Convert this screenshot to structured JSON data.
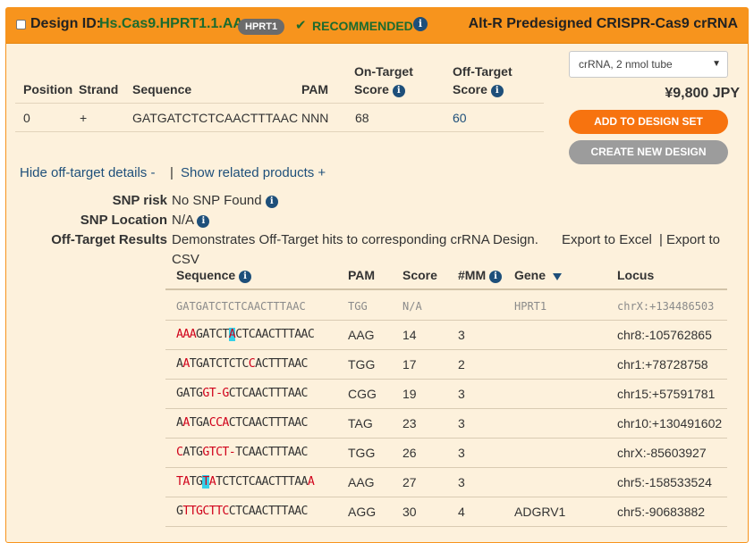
{
  "header": {
    "label": "Design ID:",
    "design_id": "Hs.Cas9.HPRT1.1.AA",
    "gene_badge": "HPRT1",
    "recommended": "RECOMMENDED",
    "product": "Alt-R Predesigned CRISPR-Cas9 crRNA"
  },
  "summary": {
    "headers": {
      "position": "Position",
      "strand": "Strand",
      "sequence": "Sequence",
      "pam": "PAM",
      "on_target_1": "On-Target",
      "on_target_2": "Score",
      "off_target_1": "Off-Target",
      "off_target_2": "Score"
    },
    "row": {
      "position": "0",
      "strand": "+",
      "sequence": "GATGATCTCTCAACTTTAAC",
      "pam": "NNN",
      "on_target": "68",
      "off_target": "60"
    }
  },
  "order": {
    "select_value": "crRNA, 2 nmol tube",
    "price": "¥9,800 JPY",
    "add_button": "ADD TO DESIGN SET",
    "create_button": "CREATE NEW DESIGN"
  },
  "details": {
    "hide_link": "Hide off-target details -",
    "separator": "|",
    "related_link": "Show related products +",
    "snp_risk_label": "SNP risk",
    "snp_risk_value": "No SNP Found",
    "snp_location_label": "SNP Location",
    "snp_location_value": "N/A",
    "off_target_label": "Off-Target Results",
    "off_target_text": "Demonstrates Off-Target hits to corresponding crRNA Design.",
    "export_excel": "Export to Excel",
    "export_sep": "|",
    "export_csv_1": "Export to",
    "export_csv_2": "CSV"
  },
  "off_target_table": {
    "headers": {
      "sequence": "Sequence",
      "pam": "PAM",
      "score": "Score",
      "mm": "#MM",
      "gene": "Gene",
      "locus": "Locus"
    },
    "rows": [
      {
        "sequence": "GATGATCTCTCAACTTTAAC",
        "pam": "TGG",
        "score": "N/A",
        "mm": "",
        "gene": "HPRT1",
        "locus": "chrX:+134486503"
      },
      {
        "sequence": "AAAGATCTACTCAACTTTAAC",
        "pam": "AAG",
        "score": "14",
        "mm": "3",
        "gene": "",
        "locus": "chr8:-105762865"
      },
      {
        "sequence": "AATGATCTCTCCACTTTAAC",
        "pam": "TGG",
        "score": "17",
        "mm": "2",
        "gene": "",
        "locus": "chr1:+78728758"
      },
      {
        "sequence": "GATGGT-GCTCAACTTTAAC",
        "pam": "CGG",
        "score": "19",
        "mm": "3",
        "gene": "",
        "locus": "chr15:+57591781"
      },
      {
        "sequence": "AATGACCACTCAACTTTAAC",
        "pam": "TAG",
        "score": "23",
        "mm": "3",
        "gene": "",
        "locus": "chr10:+130491602"
      },
      {
        "sequence": "CATGGTCT-TCAACTTTAAC",
        "pam": "TGG",
        "score": "26",
        "mm": "3",
        "gene": "",
        "locus": "chrX:-85603927"
      },
      {
        "sequence": "TATGTATCTCTCAACTTTAAA",
        "pam": "AAG",
        "score": "27",
        "mm": "3",
        "gene": "",
        "locus": "chr5:-158533524"
      },
      {
        "sequence": "GTTGCTTCCTCAACTTTAAC",
        "pam": "AGG",
        "score": "30",
        "mm": "4",
        "gene": "ADGRV1",
        "locus": "chr5:-90683882"
      }
    ]
  },
  "colors": {
    "header_orange": "#f7941d",
    "panel_background": "#fdf1dc",
    "link_blue": "#1e4f7a",
    "recommended_green": "#1c6b2e",
    "mismatch_red": "#d0021b",
    "highlight_cyan": "#35d0e8",
    "button_orange": "#f7730f",
    "button_grey": "#9c9c9c"
  },
  "icons": [
    "checkbox-icon",
    "checkmark-icon",
    "info-icon",
    "chevron-down-icon",
    "filter-icon"
  ]
}
